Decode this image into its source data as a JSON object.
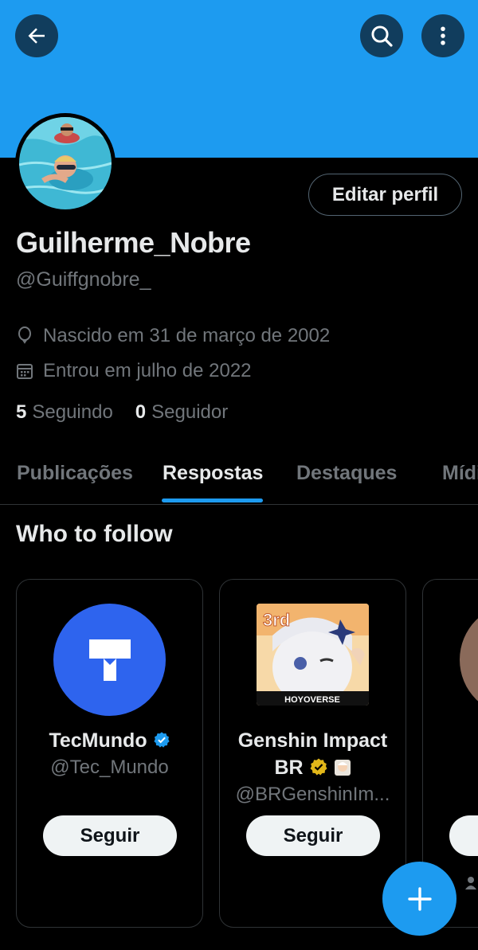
{
  "header": {
    "back_icon": "arrow-left-icon",
    "search_icon": "search-icon",
    "more_icon": "more-vertical-icon",
    "banner_color": "#1d9bf0"
  },
  "profile": {
    "edit_label": "Editar perfil",
    "display_name": "Guilherme_Nobre",
    "handle": "@Guiffgnobre_",
    "birth": "Nascido em 31 de março de 2002",
    "joined": "Entrou em julho de 2022",
    "following_count": "5",
    "following_label": "Seguindo",
    "followers_count": "0",
    "followers_label": "Seguidor"
  },
  "tabs": [
    {
      "label": "Publicações",
      "active": false
    },
    {
      "label": "Respostas",
      "active": true
    },
    {
      "label": "Destaques",
      "active": false
    },
    {
      "label": "Mídia",
      "active": false
    }
  ],
  "who_to_follow": {
    "title": "Who to follow",
    "cards": [
      {
        "name": "TecMundo",
        "handle": "@Tec_Mundo",
        "button": "Seguir",
        "verified": "blue"
      },
      {
        "name_line1": "Genshin Impact",
        "name_line2": "BR",
        "handle": "@BRGenshinIm...",
        "button": "Seguir",
        "verified": "gold",
        "logo_text": "HOYOVERSE",
        "badge_text": "3rd"
      }
    ]
  },
  "fab": {
    "icon": "plus-icon"
  },
  "colors": {
    "accent": "#1d9bf0",
    "background": "#000000",
    "muted": "#71767b"
  }
}
